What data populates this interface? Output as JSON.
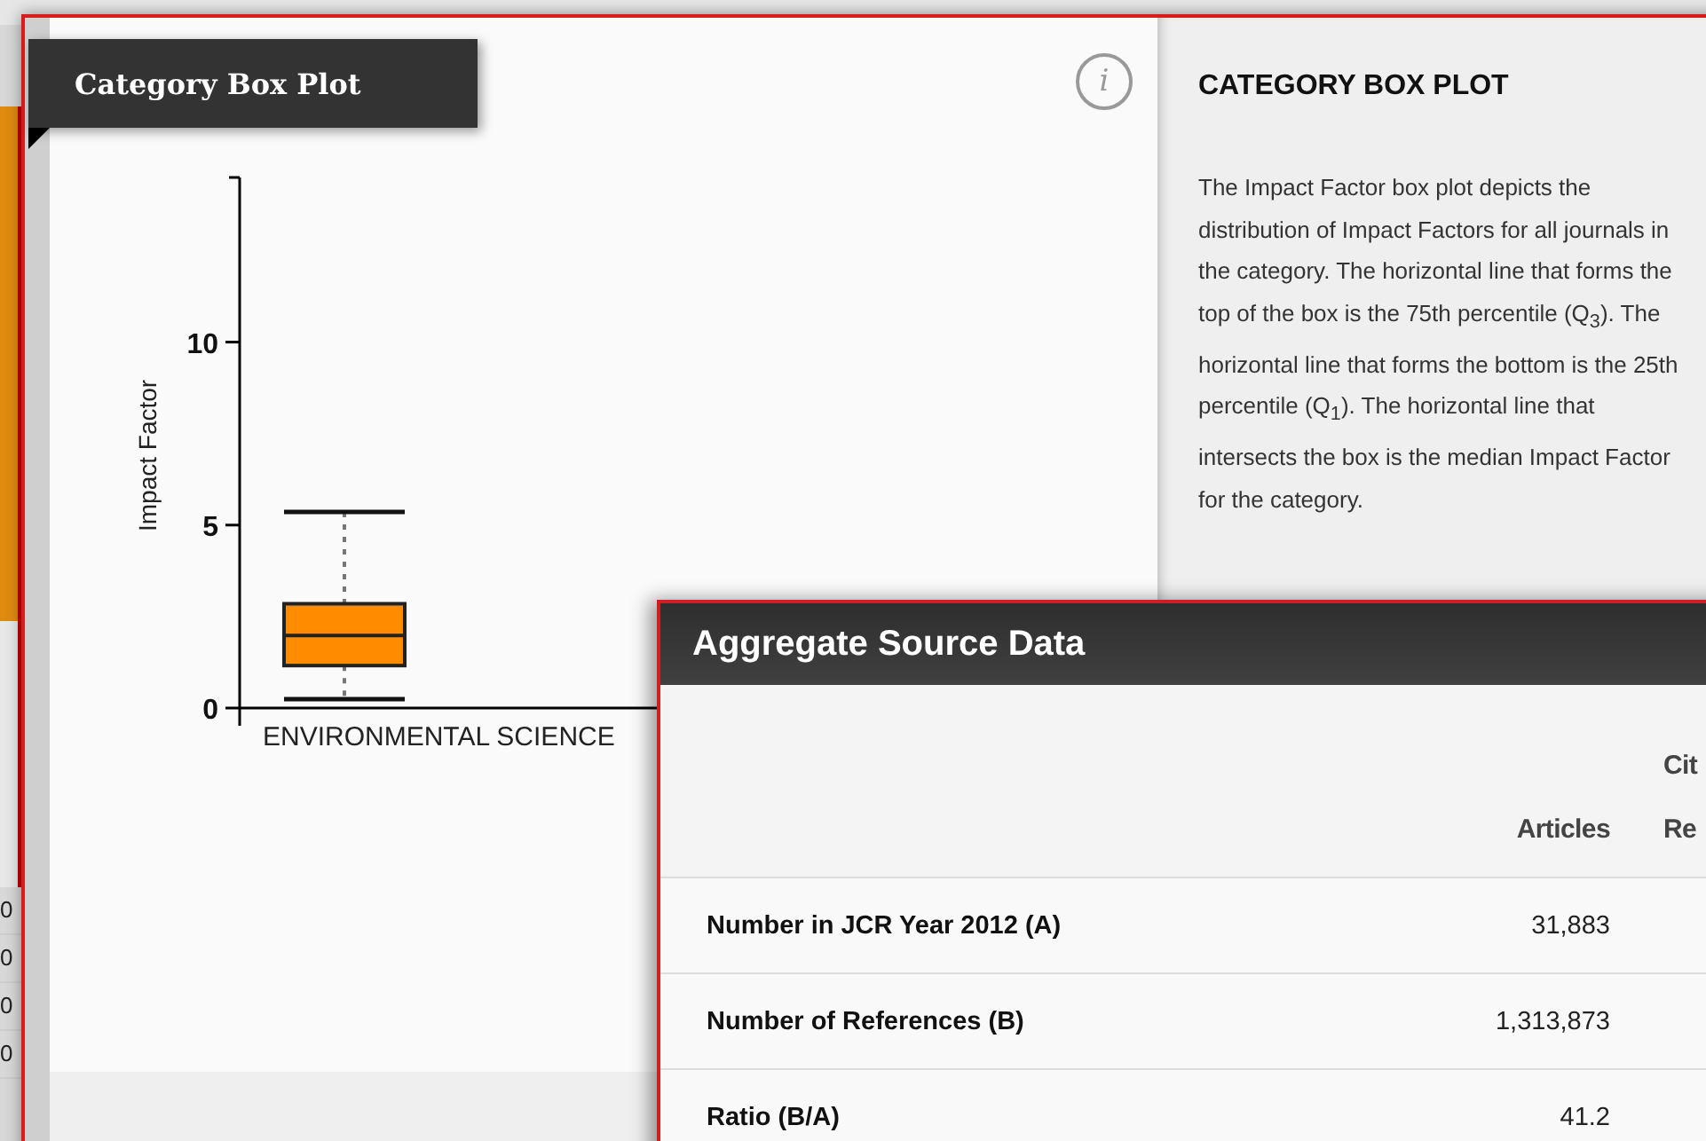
{
  "background_page": {
    "side_cells": [
      "0",
      "0",
      "0",
      "0"
    ]
  },
  "box_plot_card": {
    "title": "Category Box Plot",
    "info_button": "i",
    "chart": {
      "ylabel": "Impact Factor",
      "yticks": [
        "10",
        "5",
        "0"
      ],
      "category": "ENVIRONMENTAL SCIENCE"
    },
    "info_panel": {
      "heading": "CATEGORY BOX PLOT",
      "text": "The Impact Factor box plot depicts the distribution of Impact Factors for all journals in the category. The horizontal line that forms the top of the box is the 75th percentile (Q$_{3}$). The horizontal line that forms the bottom is the 25th percentile (Q$_{1}$). The horizontal line that intersects the box is the median Impact Factor for the category."
    }
  },
  "aggregate_panel": {
    "title": "Aggregate Source Data",
    "table": {
      "columns": [
        {
          "lines": [
            "Articles"
          ]
        },
        {
          "lines": [
            "Cit",
            "Re"
          ]
        }
      ],
      "rows": [
        {
          "label": "Number in JCR Year 2012 (A)",
          "articles": "31,883"
        },
        {
          "label": "Number of References (B)",
          "articles": "1,313,873"
        },
        {
          "label": "Ratio (B/A)",
          "articles": "41.2"
        }
      ]
    }
  }
}
